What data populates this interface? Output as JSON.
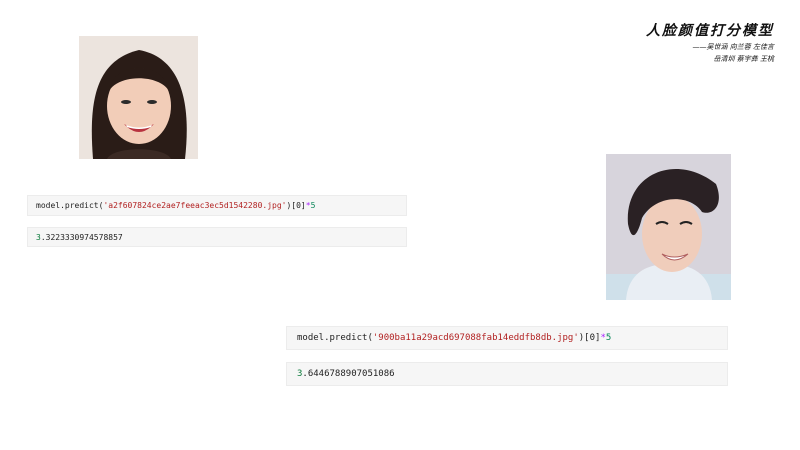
{
  "title": {
    "main": "人脸颜值打分模型",
    "credits_line1": "——吴世涵 向兰蓉 左佳言",
    "credits_line2": "岳清圳 蔡宇彝 王桃"
  },
  "cells": [
    {
      "code_prefix": "model.predict(",
      "code_string": "'a2f607824ce2ae7feeac3ec5d1542280.jpg'",
      "code_suffix": ")[0]",
      "code_op": " * ",
      "code_num": "5",
      "output_lead": "3",
      "output_rest": ".3223330974578857"
    },
    {
      "code_prefix": "model.predict(",
      "code_string": "'900ba11a29acd697088fab14eddfb8db.jpg'",
      "code_suffix": ")[0]",
      "code_op": " * ",
      "code_num": "5",
      "output_lead": "3",
      "output_rest": ".6446788907051086"
    }
  ]
}
